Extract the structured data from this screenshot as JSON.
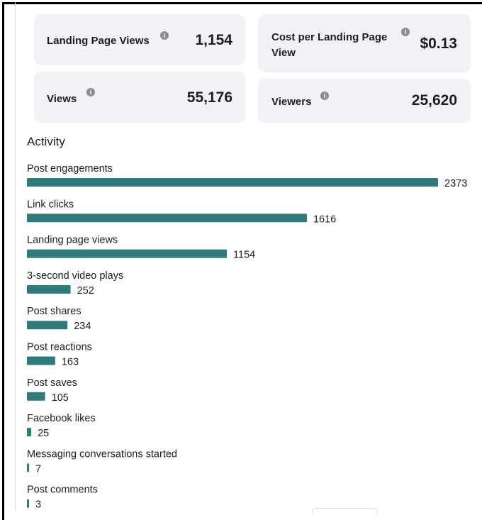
{
  "metrics": {
    "landing_page_views": {
      "label": "Landing Page Views",
      "value": "1,154"
    },
    "cost_per_landing_page_view": {
      "label_line1": "Cost per Landing Page",
      "label_line2": "View",
      "value": "$0.13"
    },
    "views": {
      "label": "Views",
      "value": "55,176"
    },
    "viewers": {
      "label": "Viewers",
      "value": "25,620"
    }
  },
  "info_glyph": "i",
  "section_title": "Activity",
  "chart_data": {
    "type": "bar",
    "orientation": "horizontal",
    "title": "Activity",
    "categories": [
      "Post engagements",
      "Link clicks",
      "Landing page views",
      "3-second video plays",
      "Post shares",
      "Post reactions",
      "Post saves",
      "Facebook likes",
      "Messaging conversations started",
      "Post comments"
    ],
    "values": [
      2373,
      1616,
      1154,
      252,
      234,
      163,
      105,
      25,
      7,
      3
    ],
    "bar_color": "#2e7b7b",
    "grid": false,
    "legend": "none"
  },
  "colors": {
    "card_bg": "#f0f2f5",
    "bar": "#2e7b7b",
    "text": "#1c1e21",
    "info_icon": "#8a8d91"
  }
}
